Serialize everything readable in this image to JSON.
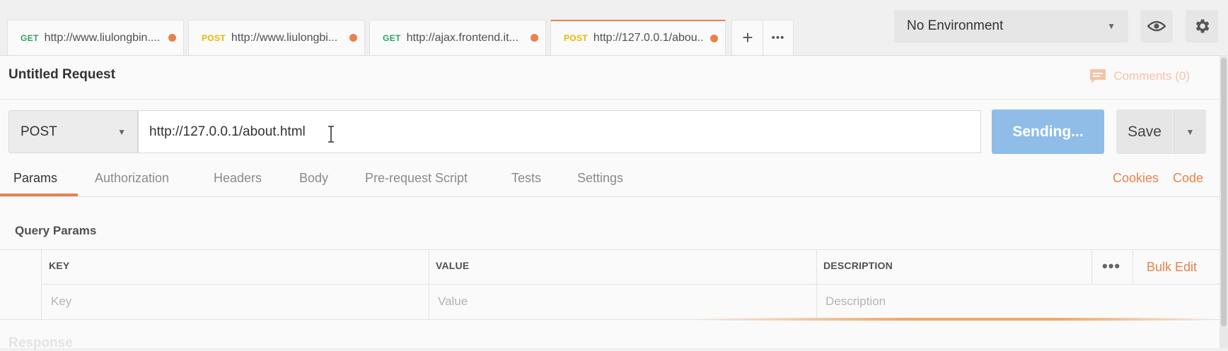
{
  "tabs": [
    {
      "method": "GET",
      "url": "http://www.liulongbin...."
    },
    {
      "method": "POST",
      "url": "http://www.liulongbi..."
    },
    {
      "method": "GET",
      "url": "http://ajax.frontend.it..."
    },
    {
      "method": "POST",
      "url": "http://127.0.0.1/abou..."
    }
  ],
  "tab_controls": {
    "add_glyph": "+",
    "more_glyph": "•••"
  },
  "environment": {
    "selected": "No Environment"
  },
  "request": {
    "title": "Untitled Request",
    "comments_label": "Comments (0)",
    "method": "POST",
    "url": "http://127.0.0.1/about.html",
    "send_label": "Sending...",
    "save_label": "Save"
  },
  "subtabs": [
    "Params",
    "Authorization",
    "Headers",
    "Body",
    "Pre-request Script",
    "Tests",
    "Settings"
  ],
  "right_links": {
    "cookies": "Cookies",
    "code": "Code"
  },
  "query_params": {
    "label": "Query Params",
    "headers": {
      "key": "KEY",
      "value": "VALUE",
      "description": "DESCRIPTION"
    },
    "placeholders": {
      "key": "Key",
      "value": "Value",
      "description": "Description"
    },
    "bulk_edit": "Bulk Edit",
    "more_glyph": "•••"
  },
  "response_label": "Response",
  "colors": {
    "accent": "#e8824a",
    "send_button": "#8fbde8",
    "get_method": "#2fa26a",
    "post_method": "#e6b800"
  },
  "icons": [
    "chevron-down-icon",
    "eye-icon",
    "gear-icon",
    "comment-icon",
    "text-cursor-icon",
    "plus-icon",
    "more-icon"
  ]
}
